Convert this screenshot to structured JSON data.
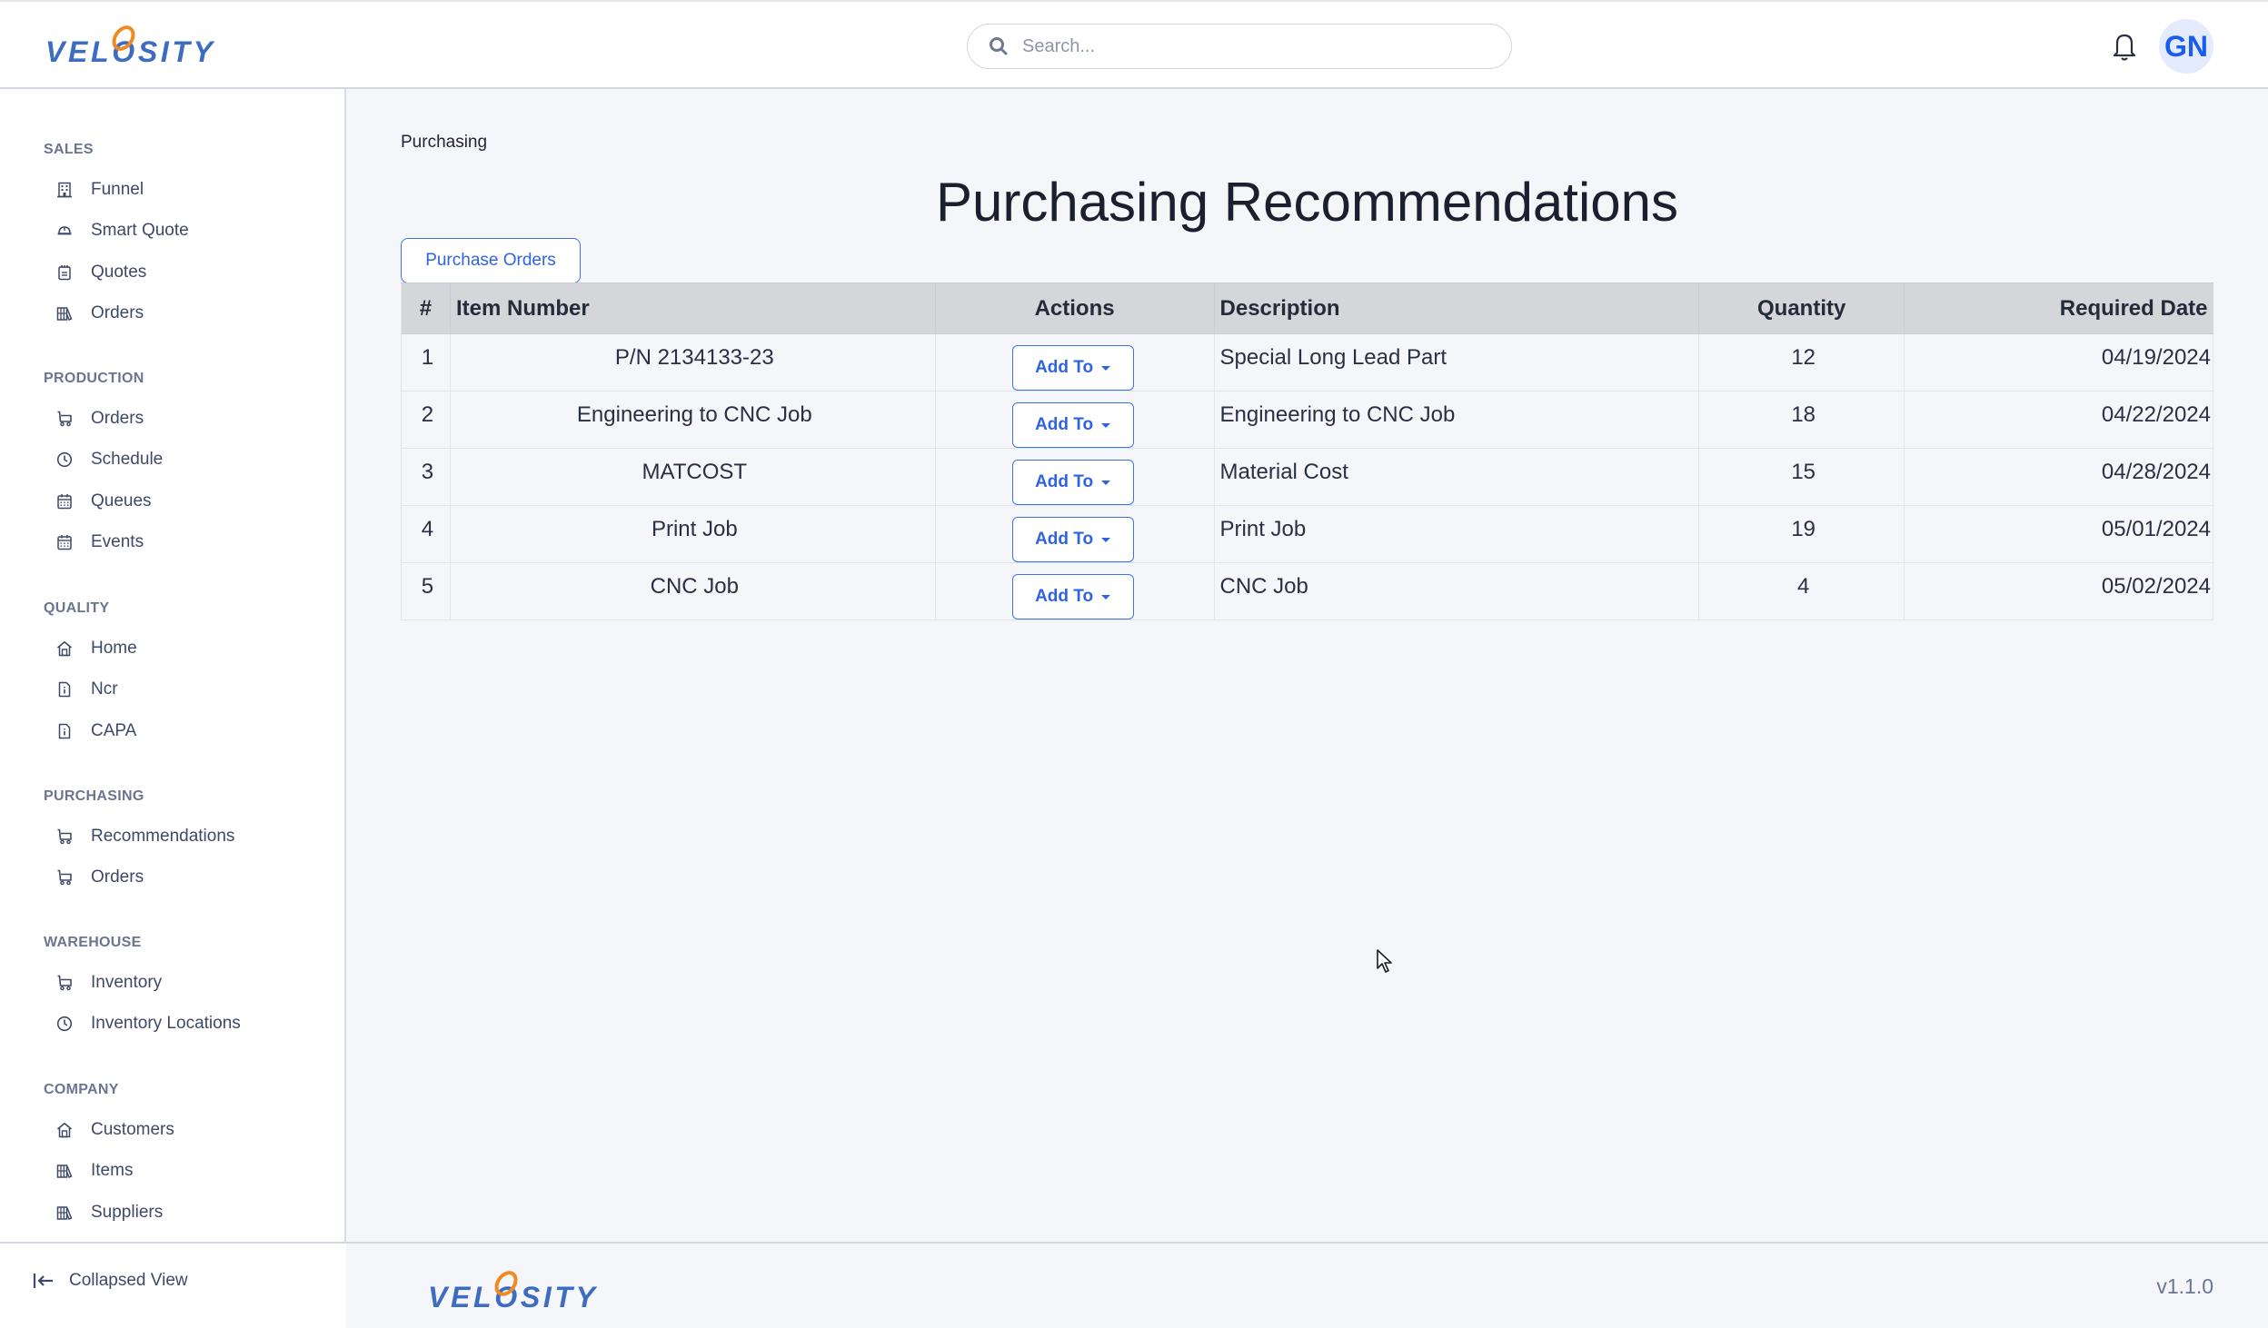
{
  "app": {
    "brand": "VELOSITY",
    "version": "v1.1.0"
  },
  "topbar": {
    "search_placeholder": "Search...",
    "search_value": "",
    "user_initials": "GN",
    "icons": {
      "search": "search-icon",
      "notifications": "bell-icon"
    }
  },
  "sidebar": {
    "sections": [
      {
        "title": "SALES",
        "items": [
          {
            "label": "Funnel",
            "icon": "building-icon"
          },
          {
            "label": "Smart Quote",
            "icon": "helmet-icon"
          },
          {
            "label": "Quotes",
            "icon": "notepad-icon"
          },
          {
            "label": "Orders",
            "icon": "books-icon"
          }
        ]
      },
      {
        "title": "PRODUCTION",
        "items": [
          {
            "label": "Orders",
            "icon": "cart-icon"
          },
          {
            "label": "Schedule",
            "icon": "clock-icon"
          },
          {
            "label": "Queues",
            "icon": "calendar-icon"
          },
          {
            "label": "Events",
            "icon": "calendar-icon"
          }
        ]
      },
      {
        "title": "QUALITY",
        "items": [
          {
            "label": "Home",
            "icon": "house-icon"
          },
          {
            "label": "Ncr",
            "icon": "file-info-icon"
          },
          {
            "label": "CAPA",
            "icon": "file-info-icon"
          }
        ]
      },
      {
        "title": "PURCHASING",
        "items": [
          {
            "label": "Recommendations",
            "icon": "cart-icon"
          },
          {
            "label": "Orders",
            "icon": "cart-icon"
          }
        ]
      },
      {
        "title": "WAREHOUSE",
        "items": [
          {
            "label": "Inventory",
            "icon": "cart-icon"
          },
          {
            "label": "Inventory Locations",
            "icon": "clock-icon"
          }
        ]
      },
      {
        "title": "COMPANY",
        "items": [
          {
            "label": "Customers",
            "icon": "house-icon"
          },
          {
            "label": "Items",
            "icon": "books-icon"
          },
          {
            "label": "Suppliers",
            "icon": "books-icon"
          }
        ]
      }
    ],
    "collapse_label": "Collapsed View"
  },
  "main": {
    "breadcrumb": "Purchasing",
    "title": "Purchasing Recommendations",
    "purchase_orders_button": "Purchase Orders",
    "table": {
      "columns": [
        "#",
        "Item Number",
        "Actions",
        "Description",
        "Quantity",
        "Required Date"
      ],
      "action_label": "Add To",
      "rows": [
        {
          "num": "1",
          "item": "P/N 2134133-23",
          "description": "Special Long Lead Part",
          "quantity": "12",
          "date": "04/19/2024"
        },
        {
          "num": "2",
          "item": "Engineering to CNC Job",
          "description": "Engineering to CNC Job",
          "quantity": "18",
          "date": "04/22/2024"
        },
        {
          "num": "3",
          "item": "MATCOST",
          "description": "Material Cost",
          "quantity": "15",
          "date": "04/28/2024"
        },
        {
          "num": "4",
          "item": "Print Job",
          "description": "Print Job",
          "quantity": "19",
          "date": "05/01/2024"
        },
        {
          "num": "5",
          "item": "CNC Job",
          "description": "CNC Job",
          "quantity": "4",
          "date": "05/02/2024"
        }
      ]
    }
  },
  "colors": {
    "brand_blue": "#3d6cc0",
    "brand_orange": "#f08a24",
    "accent": "#2f63e0",
    "avatar_bg": "#e3ebfc"
  }
}
